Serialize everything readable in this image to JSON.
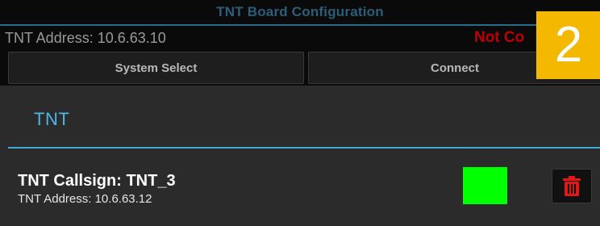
{
  "header": {
    "title": "TNT Board Configuration",
    "address_label": "TNT Address: 10.6.63.10",
    "status_label": "Not Co",
    "status_color": "#c00000"
  },
  "buttons": {
    "system_select": "System Select",
    "connect": "Connect"
  },
  "overlay": {
    "badge_number": "2",
    "badge_color": "#f5b800"
  },
  "section": {
    "title": "TNT"
  },
  "devices": [
    {
      "callsign": "TNT Callsign: TNT_3",
      "address": "TNT Address: 10.6.63.12",
      "status_color": "#00ff00",
      "delete_icon": "trash-icon"
    }
  ]
}
